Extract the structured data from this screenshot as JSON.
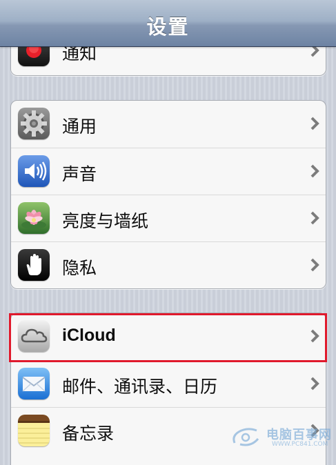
{
  "navbar": {
    "title": "设置"
  },
  "groups": {
    "top": {
      "items": [
        {
          "label": "通知",
          "icon": "notifications-icon"
        }
      ]
    },
    "system": {
      "items": [
        {
          "label": "通用",
          "icon": "gear-icon"
        },
        {
          "label": "声音",
          "icon": "speaker-icon"
        },
        {
          "label": "亮度与墙纸",
          "icon": "flower-wallpaper-icon"
        },
        {
          "label": "隐私",
          "icon": "hand-privacy-icon"
        }
      ]
    },
    "apps": {
      "items": [
        {
          "label": "iCloud",
          "icon": "cloud-icon",
          "highlighted": true
        },
        {
          "label": "邮件、通讯录、日历",
          "icon": "mail-envelope-icon"
        },
        {
          "label": "备忘录",
          "icon": "notes-pad-icon"
        }
      ]
    }
  },
  "highlight_color": "#e0192c",
  "watermark": {
    "text_cn": "电脑百事网",
    "text_en": "WWW.PC841.COM"
  }
}
